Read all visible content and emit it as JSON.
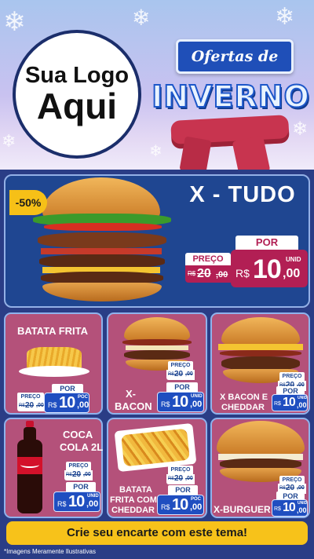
{
  "header": {
    "logo_line1": "Sua Logo",
    "logo_line2": "Aqui",
    "title_line1": "Ofertas de",
    "title_line2": "INVERNO"
  },
  "featured": {
    "badge": "-50%",
    "name": "X - TUDO",
    "por_label": "POR",
    "preco_label": "PREÇO",
    "old_currency": "R$",
    "old_int": "20",
    "old_dec": ",00",
    "new_currency": "R$",
    "new_int": "10",
    "new_dec": ",00",
    "unit": "UNID"
  },
  "products": [
    {
      "name": "BATATA FRITA",
      "preco_label": "PREÇO",
      "por_label": "POR",
      "old_currency": "R$",
      "old_int": "20",
      "old_dec": ",00",
      "new_currency": "R$",
      "new_int": "10",
      "new_dec": ",00",
      "unit": "POC"
    },
    {
      "name": "X-BACON",
      "name_l1": "X-",
      "name_l2": "BACON",
      "preco_label": "PREÇO",
      "por_label": "POR",
      "old_currency": "R$",
      "old_int": "20",
      "old_dec": ",00",
      "new_currency": "R$",
      "new_int": "10",
      "new_dec": ",00",
      "unit": "UNID"
    },
    {
      "name_l1": "X BACON E",
      "name_l2": "CHEDDAR",
      "preco_label": "PREÇO",
      "por_label": "POR",
      "old_currency": "R$",
      "old_int": "20",
      "old_dec": ",00",
      "new_currency": "R$",
      "new_int": "10",
      "new_dec": ",00",
      "unit": "UNID"
    },
    {
      "name_l1": "COCA",
      "name_l2": "COLA 2L",
      "preco_label": "PREÇO",
      "por_label": "POR",
      "old_currency": "R$",
      "old_int": "20",
      "old_dec": ",00",
      "new_currency": "R$",
      "new_int": "10",
      "new_dec": ",00",
      "unit": "UNID"
    },
    {
      "name_l1": "BATATA",
      "name_l2": "FRITA COM",
      "name_l3": "CHEDDAR",
      "preco_label": "PREÇO",
      "por_label": "POR",
      "old_currency": "R$",
      "old_int": "20",
      "old_dec": ",00",
      "new_currency": "R$",
      "new_int": "10",
      "new_dec": ",00",
      "unit": "POC"
    },
    {
      "name": "X-BURGUER",
      "preco_label": "PREÇO",
      "por_label": "POR",
      "old_currency": "R$",
      "old_int": "20",
      "old_dec": ",00",
      "new_currency": "R$",
      "new_int": "10",
      "new_dec": ",00",
      "unit": "UNID"
    }
  ],
  "footer": {
    "cta": "Crie seu encarte com este tema!",
    "disclaimer": "*Imagens Meramente Ilustrativas"
  },
  "colors": {
    "header_bg": "#b8c7f0",
    "main_bg": "#2a3d86",
    "featured_bg": "#1f4691",
    "card_bg": "#b4517a",
    "price_red": "#b21f54",
    "price_blue": "#1f4ec0",
    "cta_yellow": "#f7c21a"
  },
  "icons": [
    "snowflake-icon",
    "burger-image",
    "fries-image",
    "coca-cola-bottle-image",
    "scarf-decoration"
  ]
}
